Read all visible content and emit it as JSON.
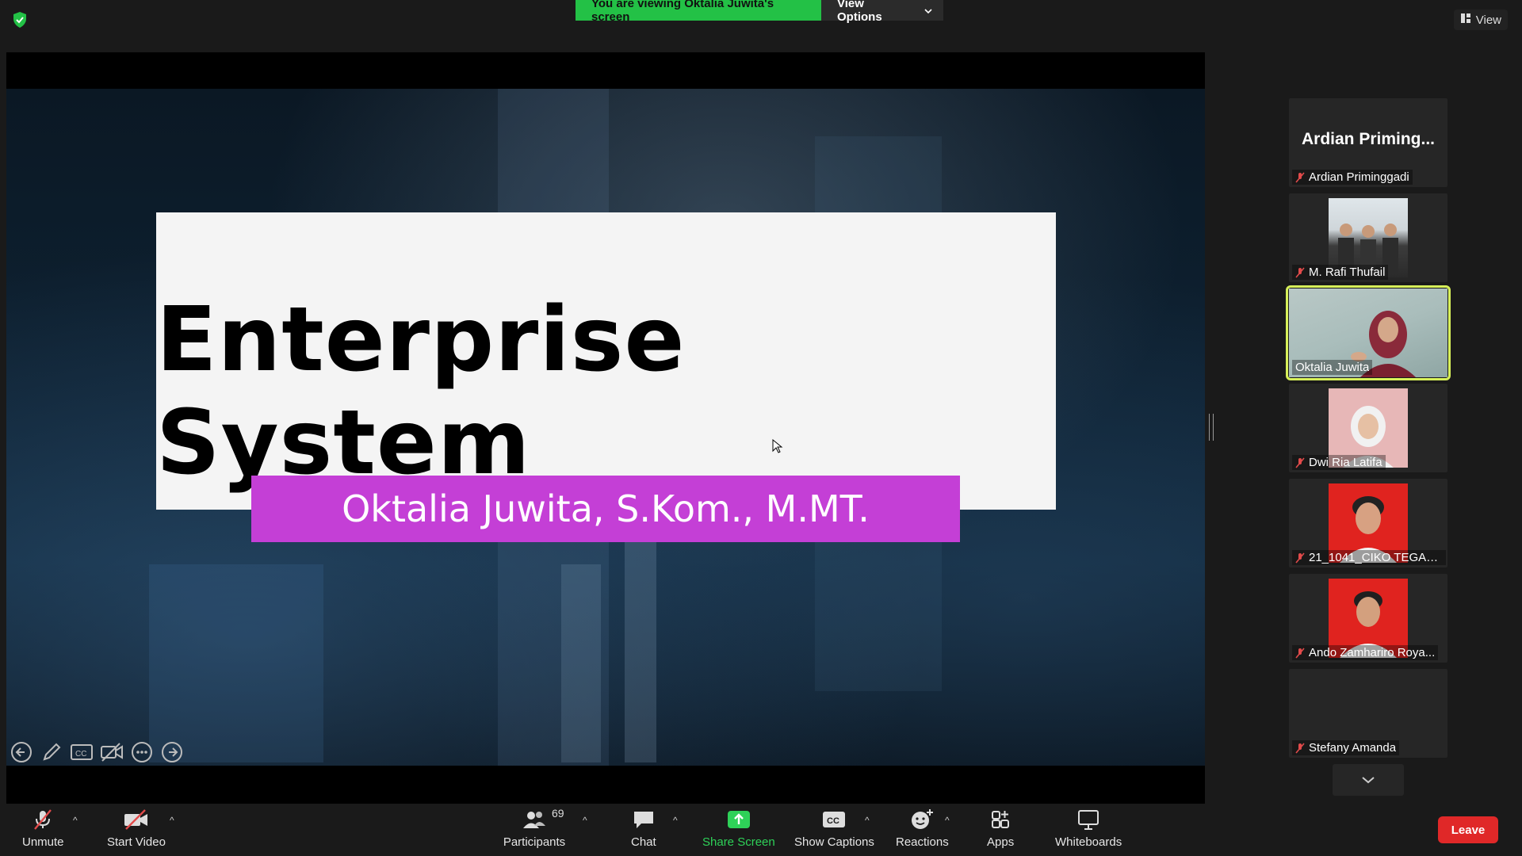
{
  "banner": {
    "viewing_text": "You are viewing Oktalia Juwita's screen",
    "view_options_label": "View Options"
  },
  "top_right": {
    "view_label": "View"
  },
  "slide": {
    "title": "Enterprise System",
    "subtitle": "Oktalia Juwita, S.Kom., M.MT."
  },
  "gallery": {
    "tiles": [
      {
        "big_name": "Ardian  Priming...",
        "name": "Ardian Priminggadi",
        "muted": true
      },
      {
        "name": "M. Rafi Thufail",
        "muted": true
      },
      {
        "name": "Oktalia Juwita",
        "muted": false,
        "active": true
      },
      {
        "name": "Dwi Ria Latifa",
        "muted": true
      },
      {
        "name": "21_1041_CIKO TEGAR ...",
        "muted": true
      },
      {
        "name": "Ando Zamhariro Roya...",
        "muted": true
      },
      {
        "name": "Stefany Amanda",
        "muted": true
      }
    ]
  },
  "toolbar": {
    "unmute": "Unmute",
    "start_video": "Start Video",
    "participants": "Participants",
    "participants_count": "69",
    "chat": "Chat",
    "share_screen": "Share Screen",
    "show_captions": "Show Captions",
    "reactions": "Reactions",
    "apps": "Apps",
    "whiteboards": "Whiteboards",
    "leave": "Leave"
  },
  "colors": {
    "banner_green": "#23c146",
    "active_speaker": "#d7f05a",
    "subtitle_bar": "#c43fd6",
    "leave_red": "#e02828",
    "share_green": "#2ed158"
  }
}
